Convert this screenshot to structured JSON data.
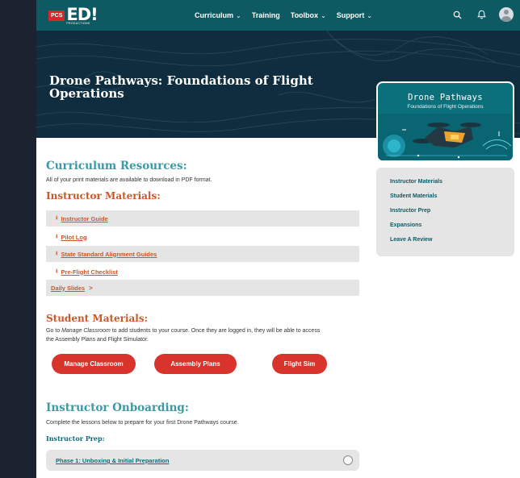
{
  "nav": {
    "logo_badge": "PCS",
    "logo_text": "ED!",
    "logo_sub": "PRODUCTIONS",
    "items": [
      {
        "label": "Curriculum",
        "dropdown": true
      },
      {
        "label": "Training",
        "dropdown": false
      },
      {
        "label": "Toolbox",
        "dropdown": true
      },
      {
        "label": "Support",
        "dropdown": true
      }
    ],
    "chevron": "⌄",
    "icons": [
      "search-icon",
      "bell-icon",
      "avatar"
    ]
  },
  "hero": {
    "title": "Drone Pathways: Foundations of Flight Operations"
  },
  "course_card": {
    "title": "Drone Pathways",
    "subtitle": "Foundations of Flight Operations"
  },
  "resources": {
    "heading": "Curriculum Resources:",
    "intro": "All of your print materials are available to download in PDF format."
  },
  "instructor_materials": {
    "heading": "Instructor Materials:",
    "download_icon": "⭳",
    "items": [
      {
        "label": "Instructor Guide"
      },
      {
        "label": "Pilot Log"
      },
      {
        "label": "State Standard Alignment Guides"
      },
      {
        "label": "Pre-Flight Checklist"
      }
    ],
    "daily_slides": "Daily Slides",
    "daily_arrow": ">"
  },
  "student_materials": {
    "heading": "Student Materials:",
    "intro_pre": "Go to ",
    "intro_em": "Manage Classroom",
    "intro_post": " to add students to your course. Once they are logged in, they will be able to access",
    "intro_line2": "the Assembly Plans and Flight Simulator.",
    "buttons": [
      {
        "label": "Manage Classroom"
      },
      {
        "label": "Assembly Plans"
      },
      {
        "label": "Flight Sim"
      }
    ]
  },
  "onboarding": {
    "heading": "Instructor Onboarding:",
    "intro": "Complete the lessons below to prepare for your first Drone Pathways course.",
    "subheading": "Instructor Prep:",
    "lesson": "Phase 1: Unboxing & Initial Preparation"
  },
  "side_menu": {
    "items": [
      {
        "label": "Instructor Materials"
      },
      {
        "label": "Student Materials"
      },
      {
        "label": "Instructor Prep"
      },
      {
        "label": "Expansions"
      },
      {
        "label": "Leave A Review"
      }
    ]
  },
  "colors": {
    "nav_bg": "#0e5a63",
    "hero_bg": "#0f2d3e",
    "teal_heading": "#3a9aa5",
    "orange": "#c8582a",
    "button_red": "#d9342b",
    "row_gray": "#e5e5e5"
  }
}
